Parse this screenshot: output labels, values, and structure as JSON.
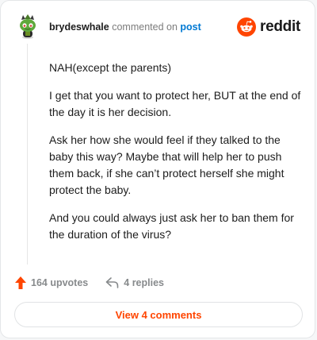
{
  "header": {
    "username": "brydeswhale",
    "commented_text": "commented on",
    "post_link": "post",
    "brand": "reddit"
  },
  "comment": {
    "paragraphs": [
      "NAH(except the parents)",
      "I get that you want to protect her, BUT at the end of the day it is her decision.",
      "Ask her how she would feel if they talked to the baby this way? Maybe that will help her to push them back, if she can’t protect herself she might protect the baby.",
      "And you could always just ask her to ban them for the duration of the virus?"
    ]
  },
  "actions": {
    "upvotes": "164 upvotes",
    "replies": "4 replies"
  },
  "footer": {
    "view_comments": "View 4 comments"
  },
  "icons": {
    "upvote": "upvote-arrow-icon",
    "reply": "reply-arrow-icon",
    "avatar": "snoo-avatar-icon",
    "brand": "reddit-logo-icon"
  },
  "colors": {
    "brand_orange": "#ff4500",
    "link_blue": "#0079d3",
    "muted_gray": "#878a8c"
  }
}
